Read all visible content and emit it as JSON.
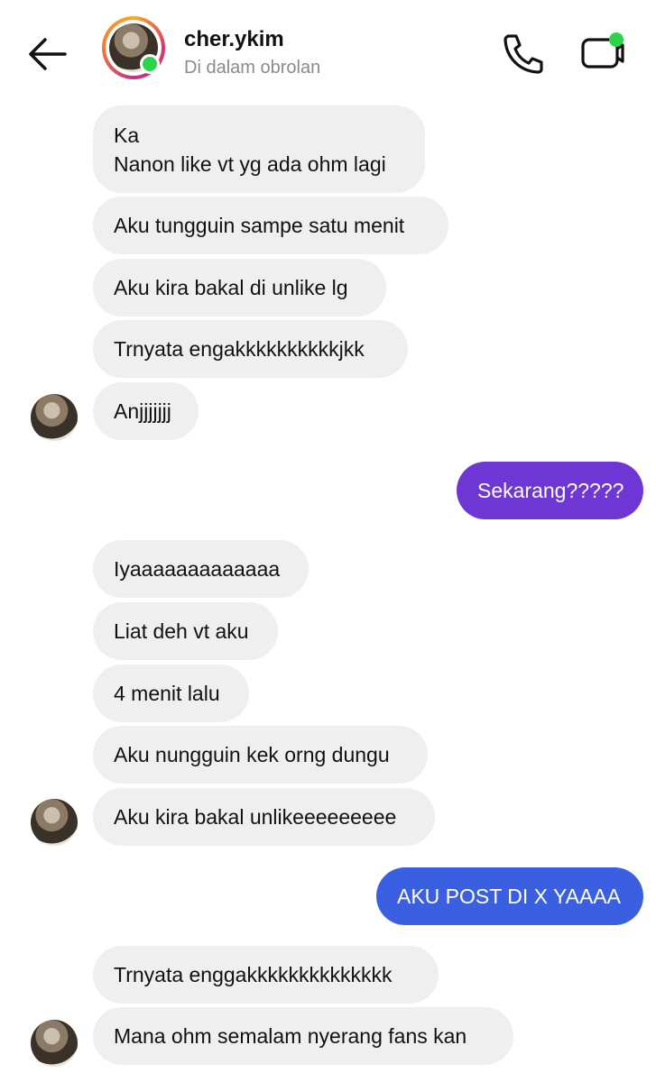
{
  "header": {
    "username": "cher.ykim",
    "status": "Di dalam obrolan"
  },
  "colors": {
    "received_bubble": "#efefef",
    "sent_bubble_1": "#6e36d4",
    "sent_bubble_2": "#3a5fe0",
    "online": "#2bd44a"
  },
  "messages": [
    {
      "from": "other",
      "text": "Ka\nNanon like vt yg ada ohm lagi"
    },
    {
      "from": "other",
      "text": "Aku tungguin sampe satu menit"
    },
    {
      "from": "other",
      "text": "Aku kira bakal di unlike lg"
    },
    {
      "from": "other",
      "text": "Trnyata engakkkkkkkkkkjkk"
    },
    {
      "from": "other",
      "text": "Anjjjjjjj"
    },
    {
      "from": "me",
      "text": "Sekarang?????"
    },
    {
      "from": "other",
      "text": "Iyaaaaaaaaaaaaa"
    },
    {
      "from": "other",
      "text": "Liat deh vt aku"
    },
    {
      "from": "other",
      "text": "4 menit lalu"
    },
    {
      "from": "other",
      "text": "Aku nungguin kek orng dungu"
    },
    {
      "from": "other",
      "text": "Aku kira bakal unlikeeeeeeeee"
    },
    {
      "from": "me",
      "text": "AKU POST DI X YAAAA"
    },
    {
      "from": "other",
      "text": "Trnyata enggakkkkkkkkkkkkkk"
    },
    {
      "from": "other",
      "text": "Mana ohm semalam nyerang fans kan"
    }
  ]
}
